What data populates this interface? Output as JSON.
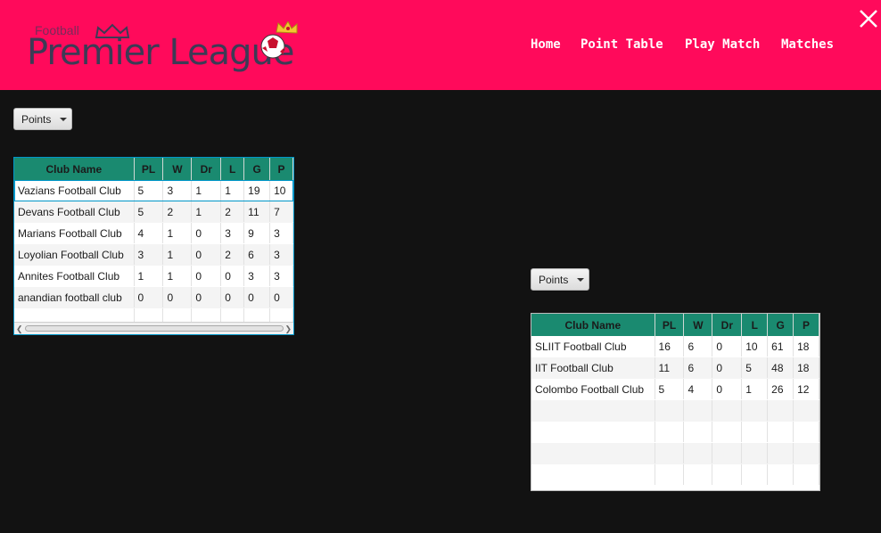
{
  "header": {
    "logo_small": "Football",
    "logo_big": "Premier League",
    "nav": [
      {
        "label": "Home"
      },
      {
        "label": "Point Table"
      },
      {
        "label": "Play Match"
      },
      {
        "label": "Matches"
      }
    ],
    "bg_color": "#ff0a5b",
    "close_icon": "close-icon"
  },
  "left": {
    "sort_dropdown": "Points",
    "columns": [
      "Club Name",
      "PL",
      "W",
      "Dr",
      "L",
      "G",
      "P"
    ],
    "rows": [
      [
        "Vazians Football Club",
        "5",
        "3",
        "1",
        "1",
        "19",
        "10"
      ],
      [
        "Devans Football Club",
        "5",
        "2",
        "1",
        "2",
        "11",
        "7"
      ],
      [
        "Marians Football Club",
        "4",
        "1",
        "0",
        "3",
        "9",
        "3"
      ],
      [
        "Loyolian Football Club",
        "3",
        "1",
        "0",
        "2",
        "6",
        "3"
      ],
      [
        "Annites Football Club",
        "1",
        "1",
        "0",
        "0",
        "3",
        "3"
      ],
      [
        "anandian football club",
        "0",
        "0",
        "0",
        "0",
        "0",
        "0"
      ],
      [
        "",
        "",
        "",
        "",
        "",
        "",
        ""
      ]
    ]
  },
  "right": {
    "sort_dropdown": "Points",
    "columns": [
      "Club Name",
      "PL",
      "W",
      "Dr",
      "L",
      "G",
      "P"
    ],
    "rows": [
      [
        "SLIIT Football Club",
        "16",
        "6",
        "0",
        "10",
        "61",
        "18"
      ],
      [
        "IIT Football Club",
        "11",
        "6",
        "0",
        "5",
        "48",
        "18"
      ],
      [
        "Colombo Football Club",
        "5",
        "4",
        "0",
        "1",
        "26",
        "12"
      ],
      [
        "",
        "",
        "",
        "",
        "",
        "",
        ""
      ],
      [
        "",
        "",
        "",
        "",
        "",
        "",
        ""
      ],
      [
        "",
        "",
        "",
        "",
        "",
        "",
        ""
      ],
      [
        "",
        "",
        "",
        "",
        "",
        "",
        ""
      ]
    ]
  }
}
